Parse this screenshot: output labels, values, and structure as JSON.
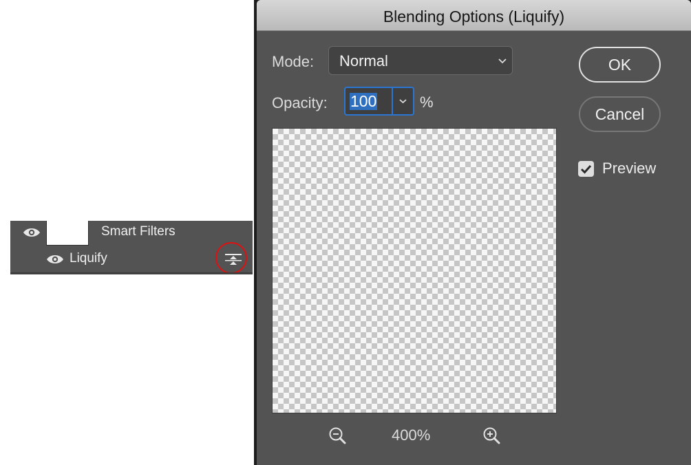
{
  "layers_panel": {
    "smart_filters_label": "Smart Filters",
    "filter_label": "Liquify",
    "smart_filters_visible": true,
    "filter_visible": true,
    "blending_options_icon": "blending-options-icon",
    "highlight_color": "#dd1111"
  },
  "dialog": {
    "title": "Blending Options (Liquify)",
    "mode_label": "Mode:",
    "mode_value": "Normal",
    "opacity_label": "Opacity:",
    "opacity_value": "100",
    "opacity_unit": "%",
    "zoom_level": "400%",
    "ok_label": "OK",
    "cancel_label": "Cancel",
    "preview_label": "Preview",
    "preview_checked": true,
    "accent_color": "#2b76d3"
  }
}
